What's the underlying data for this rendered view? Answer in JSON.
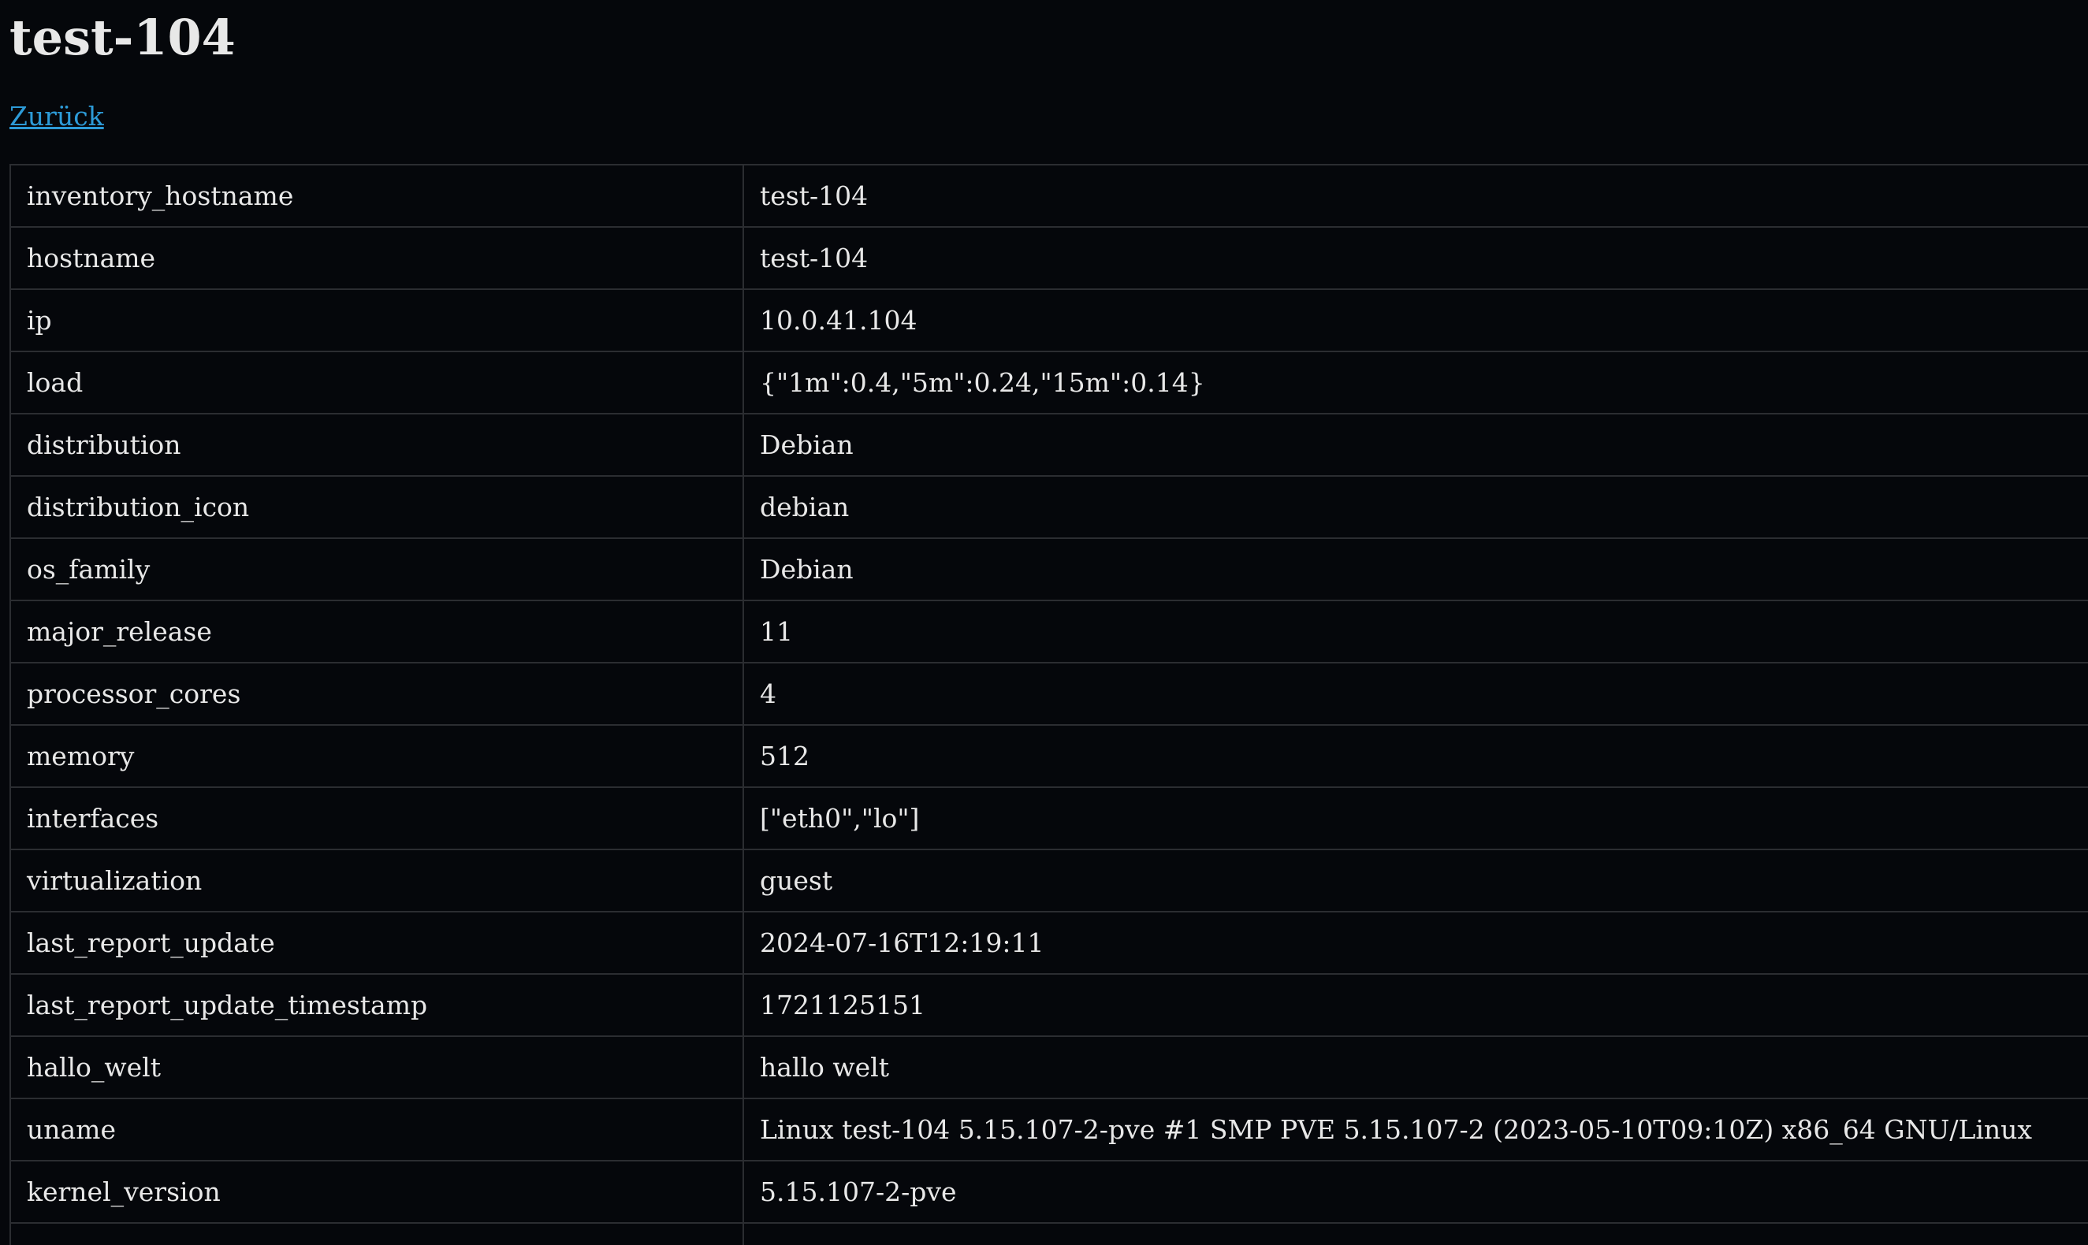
{
  "page": {
    "title": "test-104",
    "back_link": "Zurück"
  },
  "rows": [
    {
      "key": "inventory_hostname",
      "value": "test-104"
    },
    {
      "key": "hostname",
      "value": "test-104"
    },
    {
      "key": "ip",
      "value": "10.0.41.104"
    },
    {
      "key": "load",
      "value": "{\"1m\":0.4,\"5m\":0.24,\"15m\":0.14}"
    },
    {
      "key": "distribution",
      "value": "Debian"
    },
    {
      "key": "distribution_icon",
      "value": "debian"
    },
    {
      "key": "os_family",
      "value": "Debian"
    },
    {
      "key": "major_release",
      "value": "11"
    },
    {
      "key": "processor_cores",
      "value": "4"
    },
    {
      "key": "memory",
      "value": "512"
    },
    {
      "key": "interfaces",
      "value": "[\"eth0\",\"lo\"]"
    },
    {
      "key": "virtualization",
      "value": "guest"
    },
    {
      "key": "last_report_update",
      "value": "2024-07-16T12:19:11"
    },
    {
      "key": "last_report_update_timestamp",
      "value": "1721125151"
    },
    {
      "key": "hallo_welt",
      "value": "hallo welt"
    },
    {
      "key": "uname",
      "value": "Linux test-104 5.15.107-2-pve #1 SMP PVE 5.15.107-2 (2023-05-10T09:10Z) x86_64 GNU/Linux"
    },
    {
      "key": "kernel_version",
      "value": "5.15.107-2-pve"
    },
    {
      "key": "",
      "value": ""
    }
  ]
}
